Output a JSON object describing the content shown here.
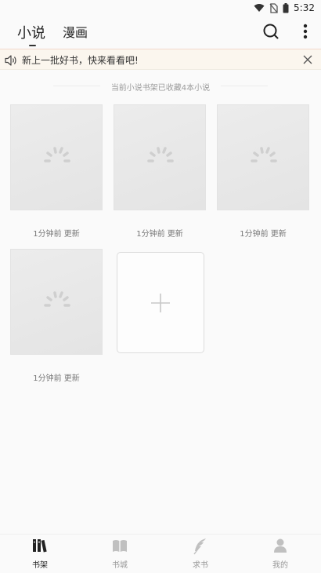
{
  "status_bar": {
    "time": "5:32"
  },
  "header": {
    "tabs": [
      {
        "label": "小说",
        "active": true
      },
      {
        "label": "漫画",
        "active": false
      }
    ]
  },
  "notice": {
    "text": "新上一批好书，快来看看吧!"
  },
  "shelf": {
    "info": "当前小说书架已收藏4本小说",
    "books": [
      {
        "update": "1分钟前 更新"
      },
      {
        "update": "1分钟前 更新"
      },
      {
        "update": "1分钟前 更新"
      },
      {
        "update": "1分钟前 更新"
      }
    ]
  },
  "bottom_nav": {
    "items": [
      {
        "label": "书架",
        "icon": "bookshelf-icon",
        "active": true
      },
      {
        "label": "书城",
        "icon": "book-open-icon",
        "active": false
      },
      {
        "label": "求书",
        "icon": "feather-icon",
        "active": false
      },
      {
        "label": "我的",
        "icon": "person-icon",
        "active": false
      }
    ]
  },
  "colors": {
    "notice_bg": "#fbf6ee",
    "active_nav": "#222222",
    "inactive_nav": "#999999"
  }
}
